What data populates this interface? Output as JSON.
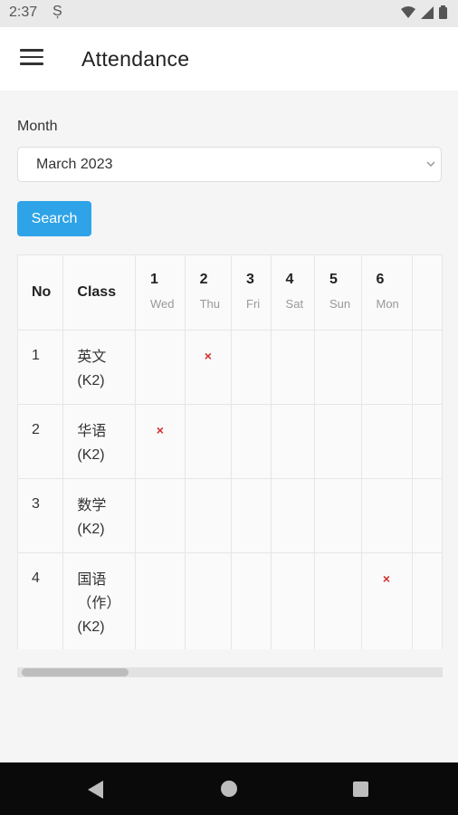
{
  "status_bar": {
    "time": "2:37",
    "notification_icon": "s-notification-icon"
  },
  "app_bar": {
    "title": "Attendance",
    "menu_icon": "hamburger-menu-icon"
  },
  "filter": {
    "month_label": "Month",
    "month_value": "March 2023",
    "search_label": "Search"
  },
  "table": {
    "headers": {
      "no": "No",
      "class": "Class"
    },
    "days": [
      {
        "day": "1",
        "weekday": "Wed"
      },
      {
        "day": "2",
        "weekday": "Thu"
      },
      {
        "day": "3",
        "weekday": "Fri"
      },
      {
        "day": "4",
        "weekday": "Sat"
      },
      {
        "day": "5",
        "weekday": "Sun"
      },
      {
        "day": "6",
        "weekday": "Mon"
      }
    ],
    "rows": [
      {
        "no": "1",
        "class_lines": [
          "英文",
          "(K2)"
        ],
        "marks": [
          "",
          "×",
          "",
          "",
          "",
          "",
          ""
        ]
      },
      {
        "no": "2",
        "class_lines": [
          "华语",
          "(K2)"
        ],
        "marks": [
          "×",
          "",
          "",
          "",
          "",
          "",
          ""
        ]
      },
      {
        "no": "3",
        "class_lines": [
          "数学",
          "(K2)"
        ],
        "marks": [
          "",
          "",
          "",
          "",
          "",
          "",
          ""
        ]
      },
      {
        "no": "4",
        "class_lines": [
          "国语",
          "（作）",
          "(K2)"
        ],
        "marks": [
          "",
          "",
          "",
          "",
          "",
          "×",
          ""
        ]
      }
    ]
  },
  "colors": {
    "accent": "#2ea3e8",
    "absent_mark": "#d32f2f"
  }
}
